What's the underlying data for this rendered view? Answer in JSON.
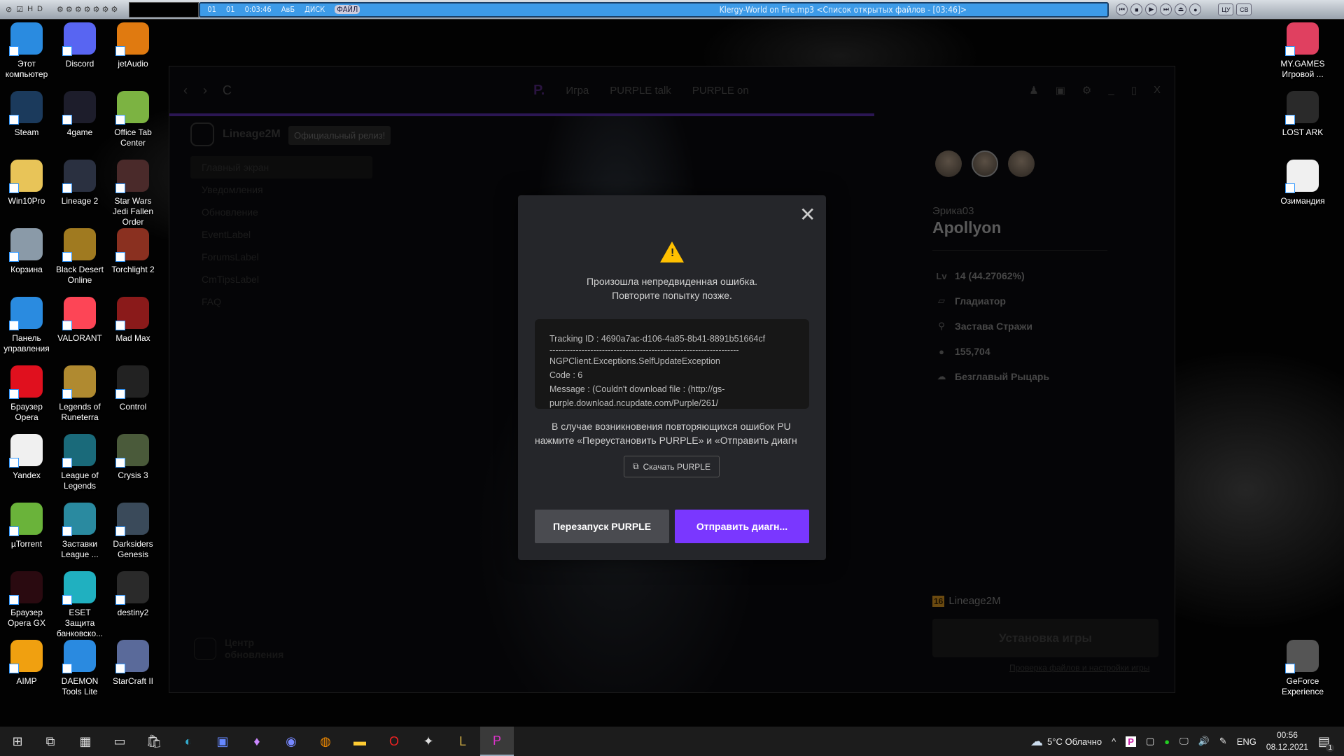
{
  "media_player": {
    "track_num": "01",
    "index": "01",
    "time": "0:03:46",
    "mode": "АвБ",
    "disc": "ДИСК",
    "file": "ФАЙЛ",
    "title": "Klergy-World on Fire.mp3   <Список открытых файлов - [03:46]>",
    "buttons": [
      "ЦУ",
      "СВ"
    ]
  },
  "desktop": {
    "left_icons": [
      {
        "label": "Этот компьютер",
        "color": "#2a8be0"
      },
      {
        "label": "Discord",
        "color": "#5865f2"
      },
      {
        "label": "jetAudio",
        "color": "#e07a10"
      },
      {
        "label": "Steam",
        "color": "#1b3a5c"
      },
      {
        "label": "4game",
        "color": "#1d1d2b"
      },
      {
        "label": "Office Tab Center",
        "color": "#7cb342"
      },
      {
        "label": "Win10Pro",
        "color": "#e8c458"
      },
      {
        "label": "Lineage 2",
        "color": "#2a3040"
      },
      {
        "label": "Star Wars Jedi Fallen Order",
        "color": "#4a2a2a"
      },
      {
        "label": "Корзина",
        "color": "#8a9aa8"
      },
      {
        "label": "Black Desert Online",
        "color": "#a07a20"
      },
      {
        "label": "Torchlight 2",
        "color": "#8a3020"
      },
      {
        "label": "Панель управления",
        "color": "#2a8be0"
      },
      {
        "label": "VALORANT",
        "color": "#fd4556"
      },
      {
        "label": "Mad Max",
        "color": "#8a1a1a"
      },
      {
        "label": "Браузер Opera",
        "color": "#e0101e"
      },
      {
        "label": "Legends of Runeterra",
        "color": "#b08a30"
      },
      {
        "label": "Control",
        "color": "#222222"
      },
      {
        "label": "Yandex",
        "color": "#f0f0f0"
      },
      {
        "label": "League of Legends",
        "color": "#1a6a7a"
      },
      {
        "label": "Crysis 3",
        "color": "#4a5a3a"
      },
      {
        "label": "µTorrent",
        "color": "#6ab33a"
      },
      {
        "label": "Заставки League ...",
        "color": "#2a8aa0"
      },
      {
        "label": "Darksiders Genesis",
        "color": "#3a4a5a"
      },
      {
        "label": "Браузер Opera GX",
        "color": "#2a0a10"
      },
      {
        "label": "ESET Защита банковско...",
        "color": "#20b0c0"
      },
      {
        "label": "destiny2",
        "color": "#2a2a2a"
      },
      {
        "label": "AIMP",
        "color": "#f0a010"
      },
      {
        "label": "DAEMON Tools Lite",
        "color": "#2a8ae0"
      },
      {
        "label": "StarCraft II",
        "color": "#5a6a9a"
      }
    ],
    "right_icons": [
      {
        "label": "MY.GAMES Игровой ...",
        "color": "#e04060"
      },
      {
        "label": "LOST ARK",
        "color": "#2a2a2a"
      },
      {
        "label": "Озимандия",
        "color": "#f0f0f0"
      },
      {
        "label": "GeForce Experience",
        "color": "#555555"
      }
    ]
  },
  "app": {
    "nav": {
      "back": "‹",
      "forward": "›",
      "reload": "C"
    },
    "tabs": [
      "Игра",
      "PURPLE talk",
      "PURPLE on"
    ],
    "game_name": "Lineage2M",
    "tooltip": "Официальный релиз!",
    "menu": [
      "Главный экран",
      "Уведомления",
      "Обновление",
      "EventLabel",
      "ForumsLabel",
      "CmTipsLabel",
      "FAQ"
    ],
    "update_center": "Центр обновления",
    "character": {
      "server": "Эрика03",
      "name": "Apollyon",
      "stats": [
        {
          "icon": "level-icon",
          "glyph": "Lv",
          "value": "14 (44.27062%)"
        },
        {
          "icon": "class-icon",
          "glyph": "▱",
          "value": "Гладиатор"
        },
        {
          "icon": "location-icon",
          "glyph": "⚲",
          "value": "Застава Стражи"
        },
        {
          "icon": "adena-icon",
          "glyph": "●",
          "value": "155,704"
        },
        {
          "icon": "pet-icon",
          "glyph": "☁",
          "value": "Безглавый Рыцарь"
        }
      ]
    },
    "age_rating": "16",
    "game_label": "Lineage2M",
    "install_button": "Установка игры",
    "check_link": "Проверка файлов и настройки игры"
  },
  "dialog": {
    "message": [
      "Произошла непредвиденная ошибка.",
      "Повторите попытку позже."
    ],
    "details": [
      "Tracking ID :  4690a7ac-d106-4a85-8b41-8891b51664cf",
      "-----------------------------------------------------------------",
      "NGPClient.Exceptions.SelfUpdateException",
      "Code : 6",
      "Message : (Couldn't download file : (http://gs-",
      "purple.download.ncupdate.com/Purple/261/"
    ],
    "help": [
      "В случае возникновения повторяющихся ошибок PU",
      "нажмите «Переустановить PURPLE» и «Отправить диагн"
    ],
    "download_button": "Скачать PURPLE",
    "restart_button": "Перезапуск PURPLE",
    "send_button": "Отправить диагн...",
    "accent": "#7a37ff"
  },
  "taskbar": {
    "weather": "5°C  Облачно",
    "lang": "ENG",
    "time": "00:56",
    "date": "08.12.2021",
    "notifications": "1"
  }
}
